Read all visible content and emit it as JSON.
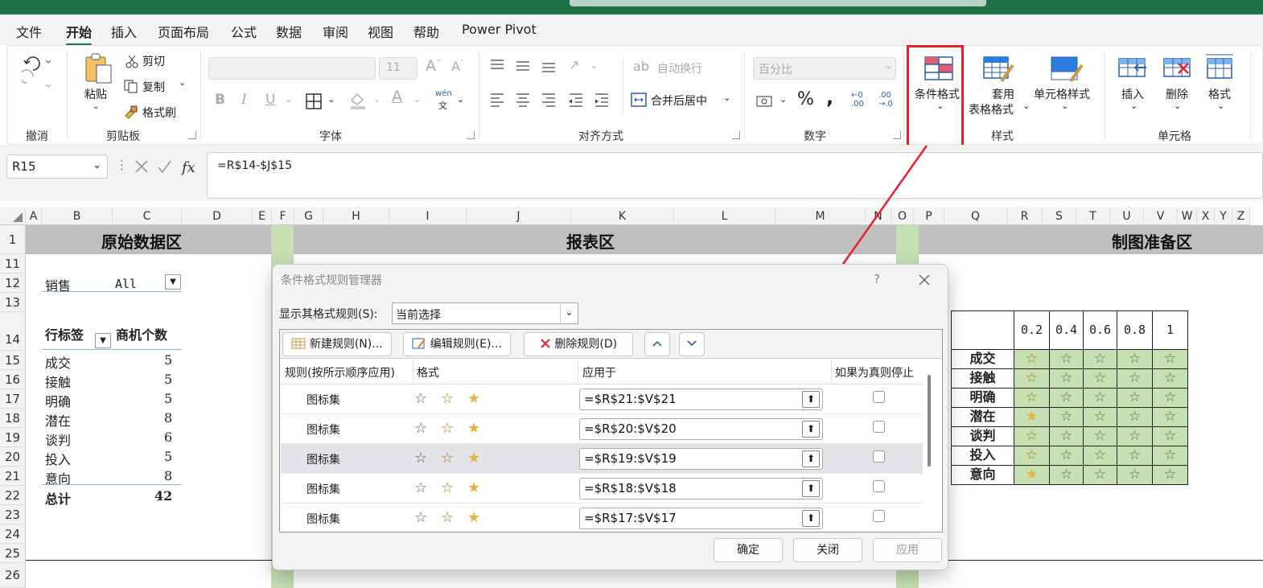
{
  "menu_tabs": [
    "文件",
    "开始",
    "插入",
    "页面布局",
    "公式",
    "数据",
    "审阅",
    "视图",
    "帮助",
    "Power Pivot"
  ],
  "active_tab": "开始",
  "ribbon": {
    "undo_group": "撤消",
    "clipboard": {
      "group": "剪贴板",
      "paste": "粘贴",
      "cut": "剪切",
      "copy": "复制",
      "format_painter": "格式刷"
    },
    "font": {
      "group": "字体",
      "size": "11",
      "bold": "B",
      "italic": "I",
      "underline": "U",
      "wen": "wén",
      "wen_char": "文"
    },
    "alignment": {
      "group": "对齐方式",
      "wrap": "自动换行",
      "merge": "合并后居中"
    },
    "number": {
      "group": "数字",
      "format": "百分比",
      "percent": "%",
      "comma": ","
    },
    "styles": {
      "group": "样式",
      "conditional": "条件格式",
      "table1": "套用",
      "table2": "表格格式",
      "cell_styles": "单元格样式"
    },
    "cells": {
      "group": "单元格",
      "insert": "插入",
      "delete": "删除",
      "format": "格式"
    }
  },
  "name_box": "R15",
  "formula": "=R$14-$J$15",
  "columns": [
    "A",
    "B",
    "C",
    "D",
    "E",
    "F",
    "G",
    "H",
    "I",
    "J",
    "K",
    "L",
    "M",
    "N",
    "O",
    "P",
    "Q",
    "R",
    "S",
    "T",
    "U",
    "V",
    "W",
    "X",
    "Y",
    "Z"
  ],
  "rows": [
    "1",
    "11",
    "12",
    "13",
    "14",
    "15",
    "16",
    "17",
    "18",
    "19",
    "20",
    "21",
    "22",
    "23",
    "24",
    "25",
    "26"
  ],
  "bands": {
    "raw": "原始数据区",
    "report": "报表区",
    "chart_prep": "制图准备区"
  },
  "pivot": {
    "filter_label": "销售",
    "filter_value": "All",
    "row_label": "行标签",
    "count_label": "商机个数",
    "items": [
      {
        "name": "成交",
        "value": "5"
      },
      {
        "name": "接触",
        "value": "5"
      },
      {
        "name": "明确",
        "value": "5"
      },
      {
        "name": "潜在",
        "value": "8"
      },
      {
        "name": "谈判",
        "value": "6"
      },
      {
        "name": "投入",
        "value": "5"
      },
      {
        "name": "意向",
        "value": "8"
      }
    ],
    "total_label": "总计",
    "total_value": "42"
  },
  "star_grid": {
    "headers": [
      "0.2",
      "0.4",
      "0.6",
      "0.8",
      "1"
    ],
    "rows": [
      "成交",
      "接触",
      "明确",
      "潜在",
      "谈判",
      "投入",
      "意向"
    ],
    "first_col_fill": [
      "half",
      "half",
      "half",
      "full",
      "half",
      "half",
      "full"
    ]
  },
  "dialog": {
    "title": "条件格式规则管理器",
    "help": "?",
    "show_rules_label": "显示其格式规则(S):",
    "show_rules_value": "当前选择",
    "new_rule": "新建规则(N)...",
    "edit_rule": "编辑规则(E)...",
    "delete_rule": "删除规则(D)",
    "col_rule": "规则(按所示顺序应用)",
    "col_format": "格式",
    "col_apply": "应用于",
    "col_stop": "如果为真则停止",
    "rules": [
      {
        "name": "图标集",
        "apply": "=$R$21:$V$21"
      },
      {
        "name": "图标集",
        "apply": "=$R$20:$V$20"
      },
      {
        "name": "图标集",
        "apply": "=$R$19:$V$19"
      },
      {
        "name": "图标集",
        "apply": "=$R$18:$V$18"
      },
      {
        "name": "图标集",
        "apply": "=$R$17:$V$17"
      }
    ],
    "selected_index": 2,
    "ok": "确定",
    "close": "关闭",
    "apply": "应用"
  },
  "colors": {
    "accent": "#1e7145",
    "highlight": "#e8202a",
    "star": "#e6b43a",
    "cell_green": "#c6e0b4",
    "band": "#bfbfbf"
  }
}
